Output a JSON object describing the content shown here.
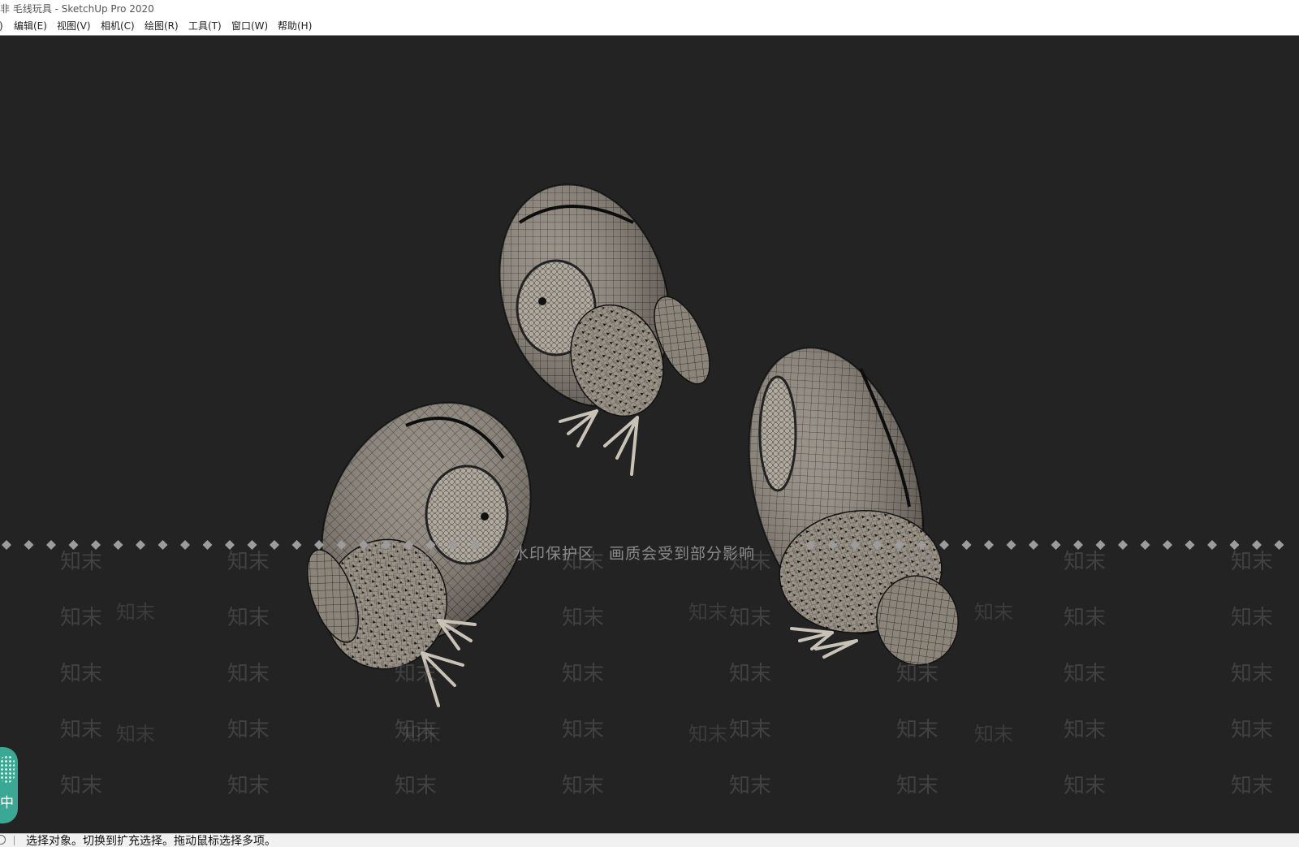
{
  "window": {
    "title": "非 毛线玩具 - SketchUp Pro 2020"
  },
  "menu": {
    "items": [
      {
        "id": "file",
        "label": ")"
      },
      {
        "id": "edit",
        "label": "编辑(E)"
      },
      {
        "id": "view",
        "label": "视图(V)"
      },
      {
        "id": "camera",
        "label": "相机(C)"
      },
      {
        "id": "draw",
        "label": "绘图(R)"
      },
      {
        "id": "tools",
        "label": "工具(T)"
      },
      {
        "id": "window",
        "label": "窗口(W)"
      },
      {
        "id": "help",
        "label": "帮助(H)"
      }
    ]
  },
  "watermark": {
    "banner_left": "水印保护区",
    "banner_right": "画质会受到部分影响",
    "tile_text": "知末"
  },
  "side_widget": {
    "label": "中"
  },
  "status": {
    "message": "选择对象。切换到扩充选择。拖动鼠标选择多项。"
  },
  "colors": {
    "viewport_bg": "#232323",
    "model_fill": "#8c8478",
    "mesh_line": "#1c1c1c",
    "widget": "#3aa894"
  },
  "icons": {
    "status_info": "info-circle-icon"
  }
}
